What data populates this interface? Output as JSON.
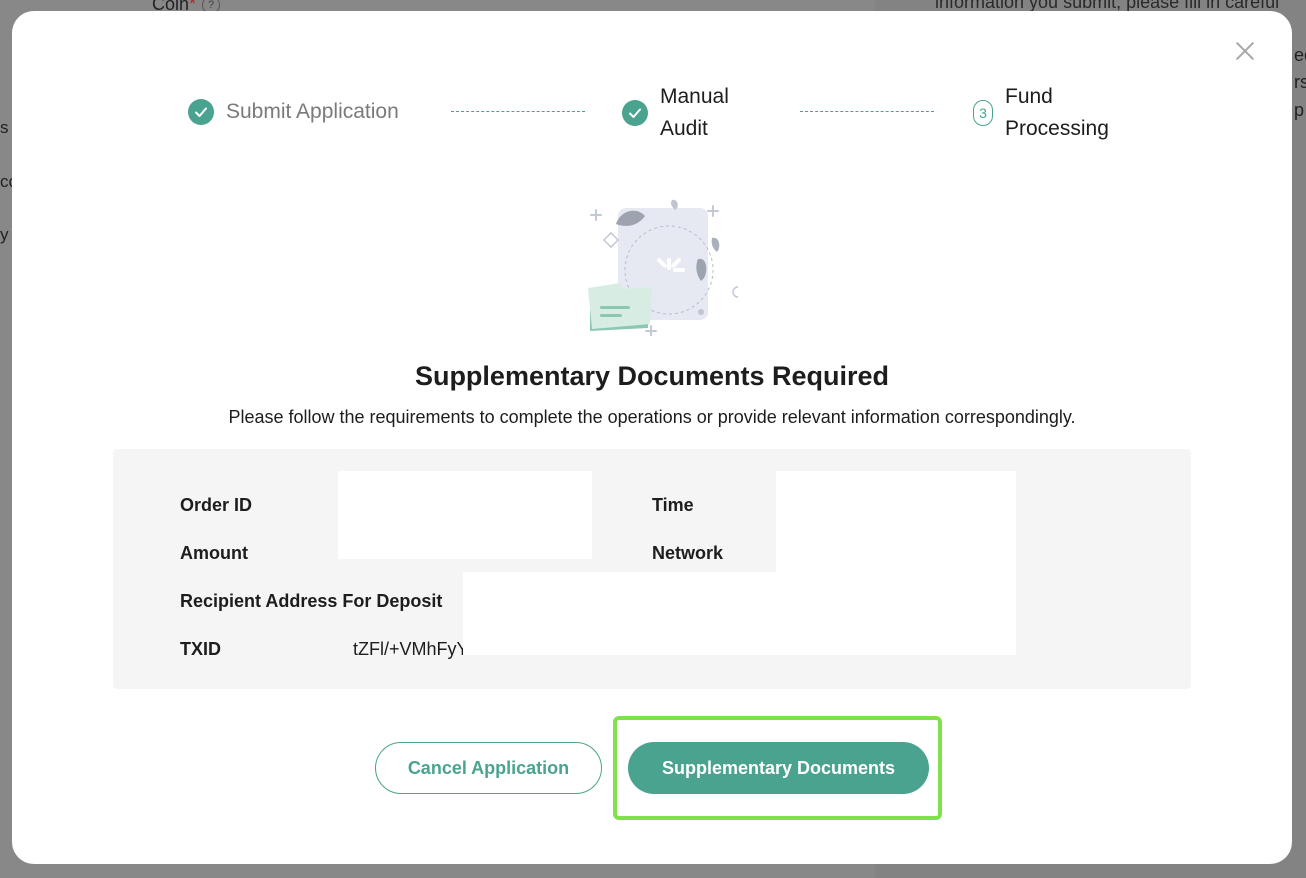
{
  "background": {
    "coin_label": "Coin",
    "required_mark": "*",
    "help_mark": "?",
    "side_fragments": [
      "s",
      "co",
      "y"
    ],
    "right_text": "information you submit, please fill in careful",
    "right_fragments": [
      "ec",
      "rs",
      "p"
    ]
  },
  "modal": {
    "close_icon": "close-icon",
    "steps": [
      {
        "label": "Submit Application",
        "state": "done"
      },
      {
        "label": "Manual Audit",
        "state": "done"
      },
      {
        "label": "Fund Processing",
        "state": "current",
        "number": "3"
      }
    ],
    "title": "Supplementary Documents Required",
    "subtitle": "Please follow the requirements to complete the operations or provide relevant information correspondingly.",
    "details": {
      "order_id_label": "Order ID",
      "time_label": "Time",
      "amount_label": "Amount",
      "network_label": "Network",
      "recipient_label": "Recipient Address For Deposit",
      "txid_label": "TXID",
      "txid_value": "tZFl/+VMhFyY"
    },
    "buttons": {
      "cancel": "Cancel Application",
      "supplementary": "Supplementary Documents"
    }
  },
  "colors": {
    "accent": "#4aa38f",
    "highlight": "#7fe24a",
    "panel_bg": "#f5f5f6"
  }
}
